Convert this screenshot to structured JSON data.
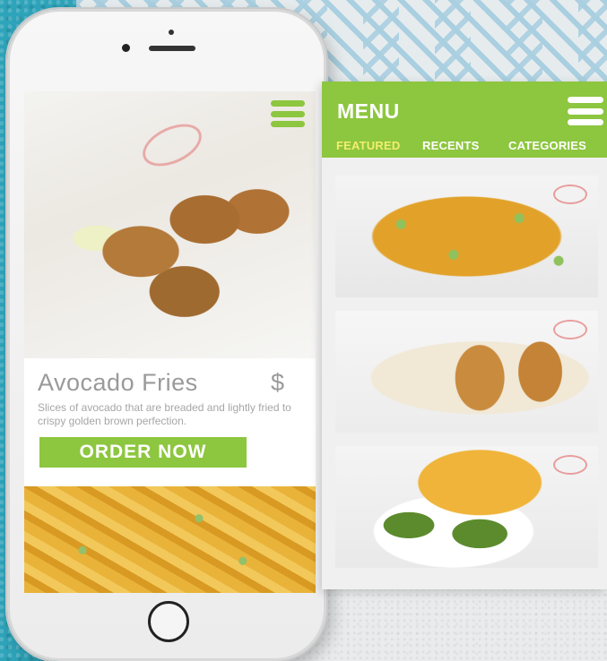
{
  "phone_screen": {
    "featured_item": {
      "title": "Avocado Fries",
      "price": "$",
      "description": "Slices of avocado that are breaded and lightly fried to crispy golden brown perfection.",
      "order_button": "ORDER NOW"
    }
  },
  "app_panel": {
    "title": "MENU",
    "tabs": [
      {
        "label": "FEATURED",
        "active": true
      },
      {
        "label": "RECENTS",
        "active": false
      },
      {
        "label": "CATEGORIES",
        "active": false
      }
    ]
  },
  "colors": {
    "accent_green": "#8dc63f",
    "active_tab": "#f3ee6f",
    "background_teal": "#2ea4ba"
  },
  "icons": [
    "menu-icon",
    "home-button"
  ]
}
